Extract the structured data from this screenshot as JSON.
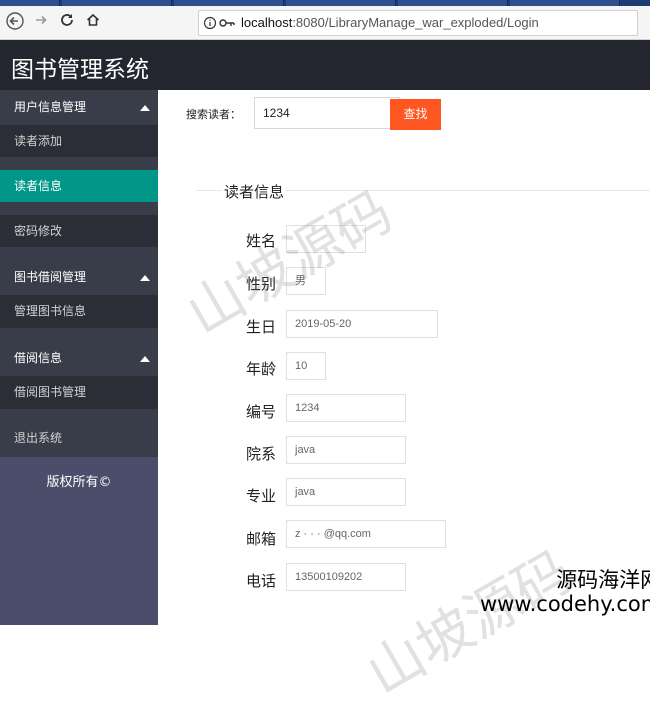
{
  "browser": {
    "url_host": "localhost",
    "url_rest": ":8080/LibraryManage_war_exploded/Login"
  },
  "header": {
    "title": "图书管理系统"
  },
  "sidebar": {
    "items": [
      {
        "label": "用户信息管理",
        "kind": "group"
      },
      {
        "label": "读者添加",
        "kind": "sub"
      },
      {
        "label": "读者信息",
        "kind": "active"
      },
      {
        "label": "密码修改",
        "kind": "sub"
      },
      {
        "label": "图书借阅管理",
        "kind": "group"
      },
      {
        "label": "管理图书信息",
        "kind": "sub"
      },
      {
        "label": "借阅信息",
        "kind": "group"
      },
      {
        "label": "借阅图书管理",
        "kind": "sub"
      },
      {
        "label": "退出系统",
        "kind": "plain"
      }
    ],
    "copyright": "版权所有©"
  },
  "search": {
    "label": "搜索读者：",
    "value": "1234",
    "button": "查找"
  },
  "reader": {
    "legend": "读者信息",
    "fields": [
      {
        "label": "姓名",
        "value": ""
      },
      {
        "label": "性别",
        "value": "男"
      },
      {
        "label": "生日",
        "value": "2019-05-20"
      },
      {
        "label": "年龄",
        "value": "10"
      },
      {
        "label": "编号",
        "value": "1234"
      },
      {
        "label": "院系",
        "value": "java"
      },
      {
        "label": "专业",
        "value": "java"
      },
      {
        "label": "邮箱",
        "value": "z · ·  · @qq.com"
      },
      {
        "label": "电话",
        "value": "13500109202"
      }
    ]
  },
  "watermarks": {
    "mark": "山坡源码",
    "site_name": "源码海洋网",
    "site_url": "www.codehy.com"
  }
}
